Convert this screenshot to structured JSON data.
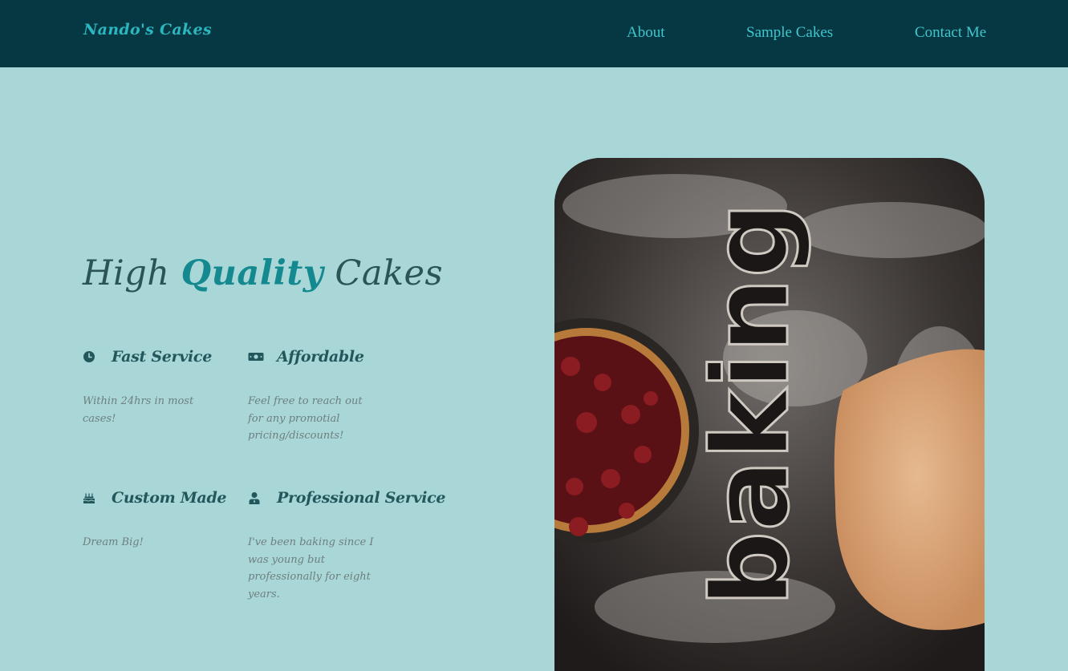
{
  "nav": {
    "brand": "Nando's Cakes",
    "links": [
      "About",
      "Sample Cakes",
      "Contact Me"
    ]
  },
  "hero": {
    "title_parts": [
      "High ",
      "Quality",
      " Cakes"
    ],
    "image_text": "baking"
  },
  "features": [
    {
      "icon": "clock-icon",
      "title": "Fast Service",
      "desc": "Within 24hrs in most cases!"
    },
    {
      "icon": "money-icon",
      "title": "Affordable",
      "desc": "Feel free to reach out for any promotial pricing/discounts!"
    },
    {
      "icon": "cake-icon",
      "title": "Custom Made",
      "desc": "Dream Big!"
    },
    {
      "icon": "user-icon",
      "title": "Professional Service",
      "desc": "I've been baking since I was young but professionally for eight years."
    }
  ],
  "colors": {
    "navbar_bg": "#053843",
    "page_bg": "#a9d6d7",
    "accent": "#14898f",
    "nav_link": "#3ec7cf"
  }
}
